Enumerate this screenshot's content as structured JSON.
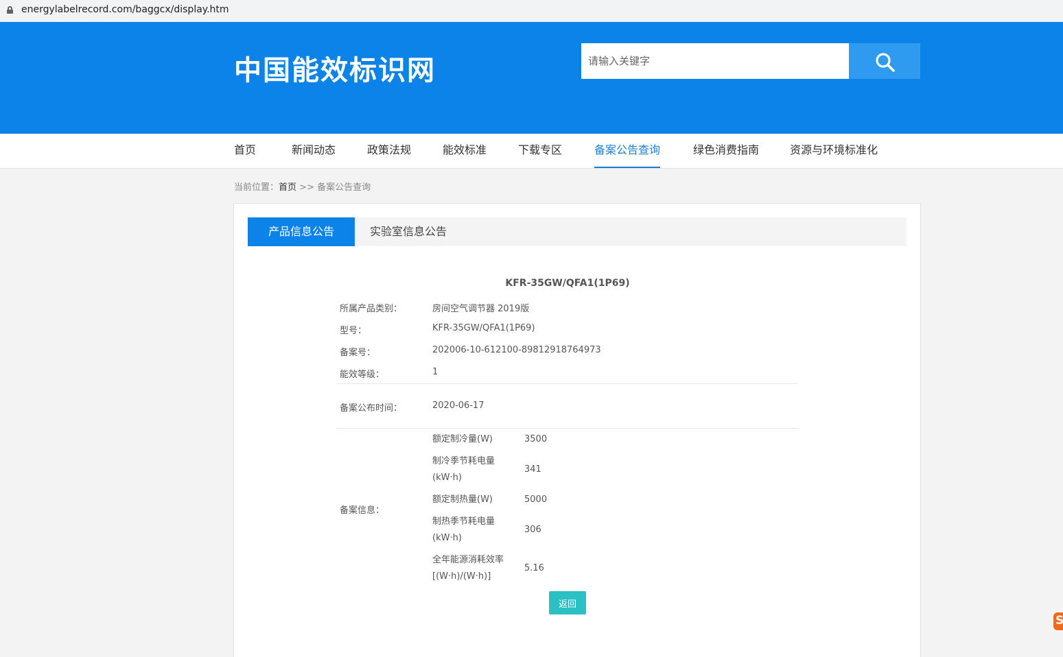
{
  "browser": {
    "url": "energylabelrecord.com/baggcx/display.htm"
  },
  "header": {
    "logo": "中国能效标识网",
    "search_placeholder": "请输入关键字"
  },
  "nav": {
    "items": [
      "首页",
      "新闻动态",
      "政策法规",
      "能效标准",
      "下载专区",
      "备案公告查询",
      "绿色消费指南",
      "资源与环境标准化"
    ],
    "active": "备案公告查询"
  },
  "breadcrumb": {
    "prefix": "当前位置：",
    "home": "首页",
    "separator": ">>",
    "current": "备案公告查询"
  },
  "tabs": [
    "产品信息公告",
    "实验室信息公告"
  ],
  "product": {
    "title": "KFR-35GW/QFA1(1P69)",
    "fields": [
      {
        "label": "所属产品类别：",
        "value": "房间空气调节器 2019版"
      },
      {
        "label": "型号：",
        "value": "KFR-35GW/QFA1(1P69)"
      },
      {
        "label": "备案号：",
        "value": "202006-10-612100-89812918764973"
      },
      {
        "label": "能效等级：",
        "value": "1"
      }
    ],
    "publish": {
      "label": "备案公布时间：",
      "value": "2020-06-17"
    },
    "record": {
      "label": "备案信息：",
      "items": [
        {
          "name": "额定制冷量(W)",
          "value": "3500"
        },
        {
          "name": "制冷季节耗电量(kW·h)",
          "value": "341"
        },
        {
          "name": "额定制热量(W)",
          "value": "5000"
        },
        {
          "name": "制热季节耗电量(kW·h)",
          "value": "306"
        },
        {
          "name": "全年能源消耗效率[(W·h)/(W·h)]",
          "value": "5.16"
        }
      ]
    }
  },
  "back_label": "返回"
}
